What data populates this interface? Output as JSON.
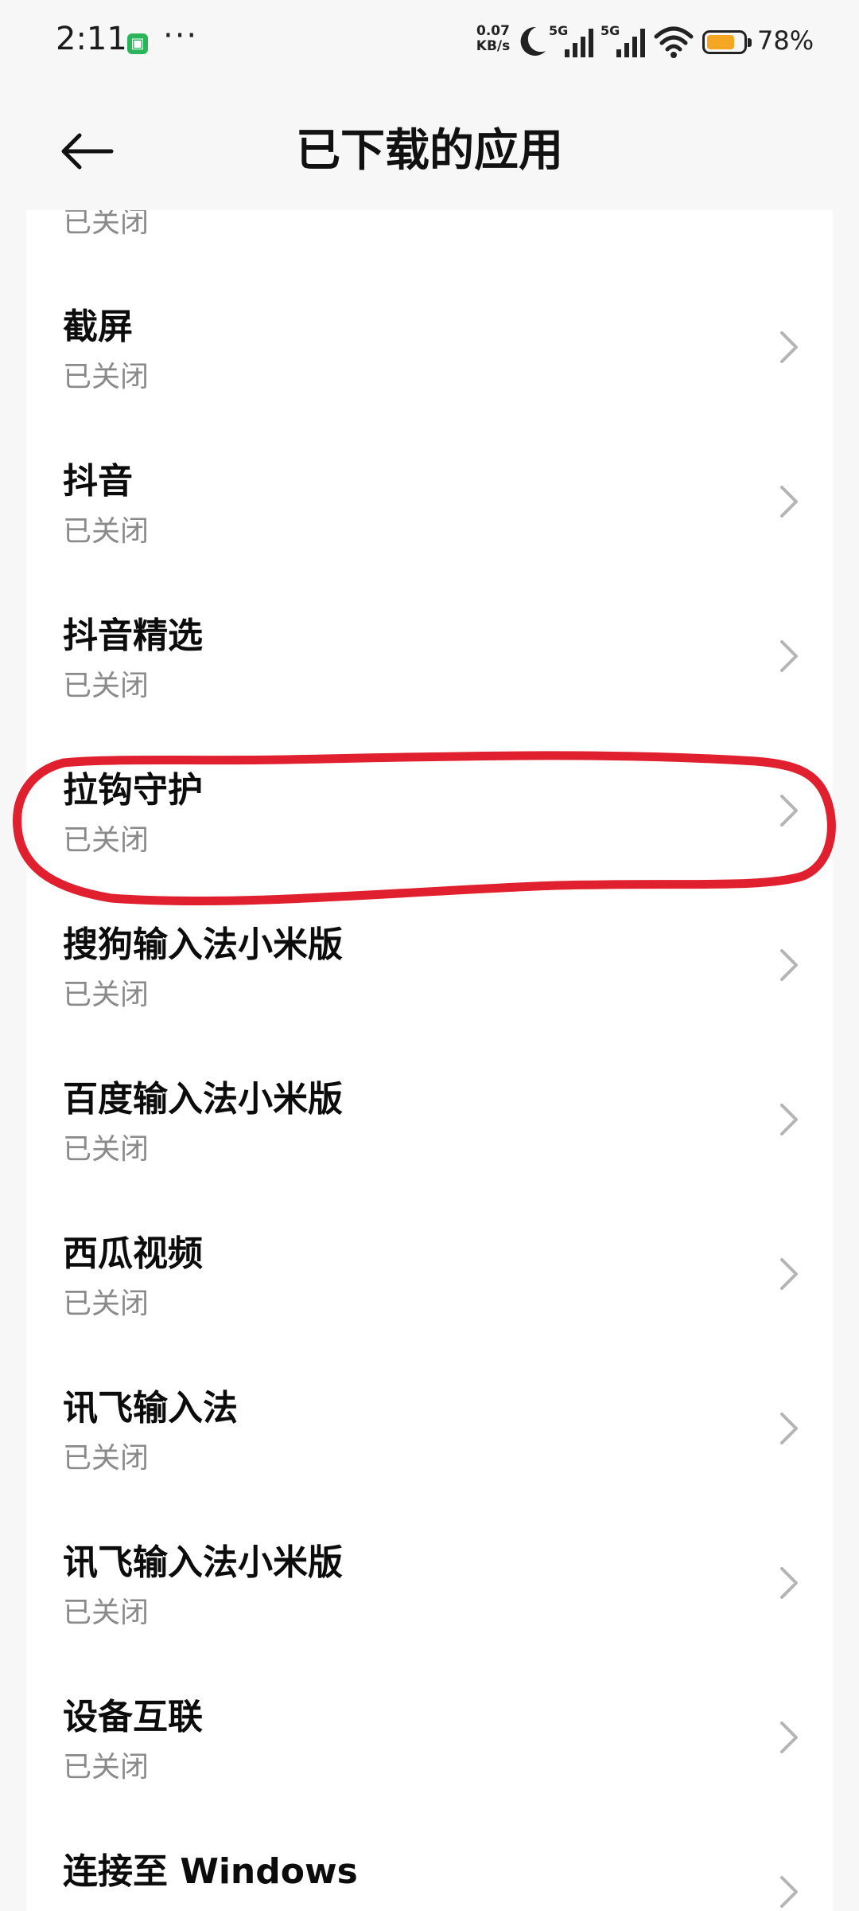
{
  "status_bar": {
    "time": "2:11",
    "net_speed_value": "0.07",
    "net_speed_unit": "KB/s",
    "sim1_label": "5G",
    "sim2_label": "5G",
    "battery_percent": "78%",
    "battery_level": 0.78,
    "more_dots": "···",
    "notification_icon": "app-notification-icon"
  },
  "header": {
    "title": "已下载的应用"
  },
  "apps": [
    {
      "name": "",
      "status": "已关闭"
    },
    {
      "name": "截屏",
      "status": "已关闭"
    },
    {
      "name": "抖音",
      "status": "已关闭"
    },
    {
      "name": "抖音精选",
      "status": "已关闭"
    },
    {
      "name": "拉钩守护",
      "status": "已关闭"
    },
    {
      "name": "搜狗输入法小米版",
      "status": "已关闭"
    },
    {
      "name": "百度输入法小米版",
      "status": "已关闭"
    },
    {
      "name": "西瓜视频",
      "status": "已关闭"
    },
    {
      "name": "讯飞输入法",
      "status": "已关闭"
    },
    {
      "name": "讯飞输入法小米版",
      "status": "已关闭"
    },
    {
      "name": "设备互联",
      "status": "已关闭"
    },
    {
      "name": "连接至 Windows",
      "status": ""
    }
  ],
  "colors": {
    "accent_annotation": "#e0202e",
    "status_text": "#8a8a8a",
    "battery_fill": "#f5a623"
  }
}
